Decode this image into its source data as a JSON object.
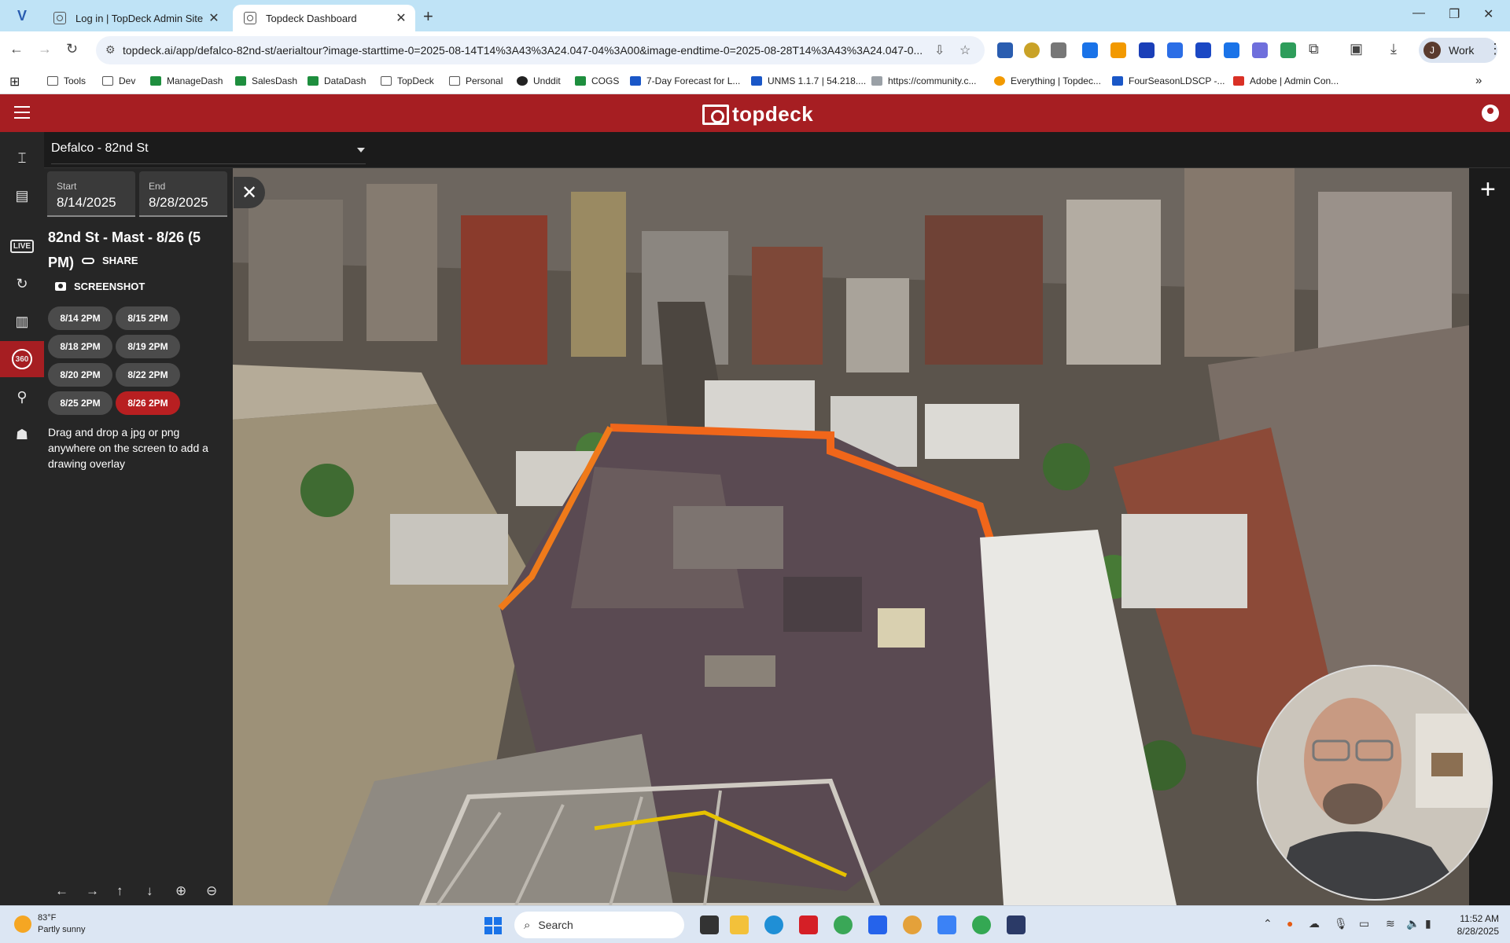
{
  "browser": {
    "tabs": [
      {
        "label": "Log in | TopDeck Admin Site",
        "active": false
      },
      {
        "label": "Topdeck Dashboard",
        "active": true
      }
    ],
    "url": "topdeck.ai/app/defalco-82nd-st/aerialtour?image-starttime-0=2025-08-14T14%3A43%3A24.047-04%3A00&image-endtime-0=2025-08-28T14%3A43%3A24.047-0...",
    "profile_label": "Work",
    "profile_initial": "J",
    "bookmarks": [
      {
        "label": "Tools",
        "icon": "folder"
      },
      {
        "label": "Dev",
        "icon": "folder"
      },
      {
        "label": "ManageDash",
        "icon": "green"
      },
      {
        "label": "SalesDash",
        "icon": "green"
      },
      {
        "label": "DataDash",
        "icon": "green"
      },
      {
        "label": "TopDeck",
        "icon": "folder"
      },
      {
        "label": "Personal",
        "icon": "folder"
      },
      {
        "label": "Unddit",
        "icon": "black"
      },
      {
        "label": "COGS",
        "icon": "green"
      },
      {
        "label": "7-Day Forecast for L...",
        "icon": "blue"
      },
      {
        "label": "UNMS 1.1.7 | 54.218....",
        "icon": "blue"
      },
      {
        "label": "https://community.c...",
        "icon": "gray"
      },
      {
        "label": "Everything | Topdec...",
        "icon": "orange"
      },
      {
        "label": "FourSeasonLDSCP -...",
        "icon": "blue"
      },
      {
        "label": "Adobe | Admin Con...",
        "icon": "red"
      }
    ]
  },
  "app": {
    "brand": "topdeck",
    "project": "Defalco - 82nd St",
    "start_label": "Start",
    "start_value": "8/14/2025",
    "end_label": "End",
    "end_value": "8/28/2025",
    "tour_title": "82nd St - Mast - 8/26 (5 PM)",
    "share_label": "SHARE",
    "screenshot_label": "SCREENSHOT",
    "captures": [
      "8/14 2PM",
      "8/15 2PM",
      "8/18 2PM",
      "8/19 2PM",
      "8/20 2PM",
      "8/22 2PM",
      "8/25 2PM",
      "8/26 2PM"
    ],
    "selected_capture": "8/26 2PM",
    "hint": "Drag and drop a jpg or png anywhere on the screen to add a drawing overlay",
    "rail_icons": [
      "crane-icon",
      "report-icon",
      "live-icon",
      "history-icon",
      "gallery-icon",
      "360-icon",
      "drone-icon",
      "team-icon"
    ],
    "rail_live_text": "LIVE",
    "rail_360_text": "360",
    "accent": "#a61e22"
  },
  "taskbar": {
    "weather_temp": "83°F",
    "weather_desc": "Partly sunny",
    "search_label": "Search",
    "time": "11:52 AM",
    "date": "8/28/2025"
  }
}
